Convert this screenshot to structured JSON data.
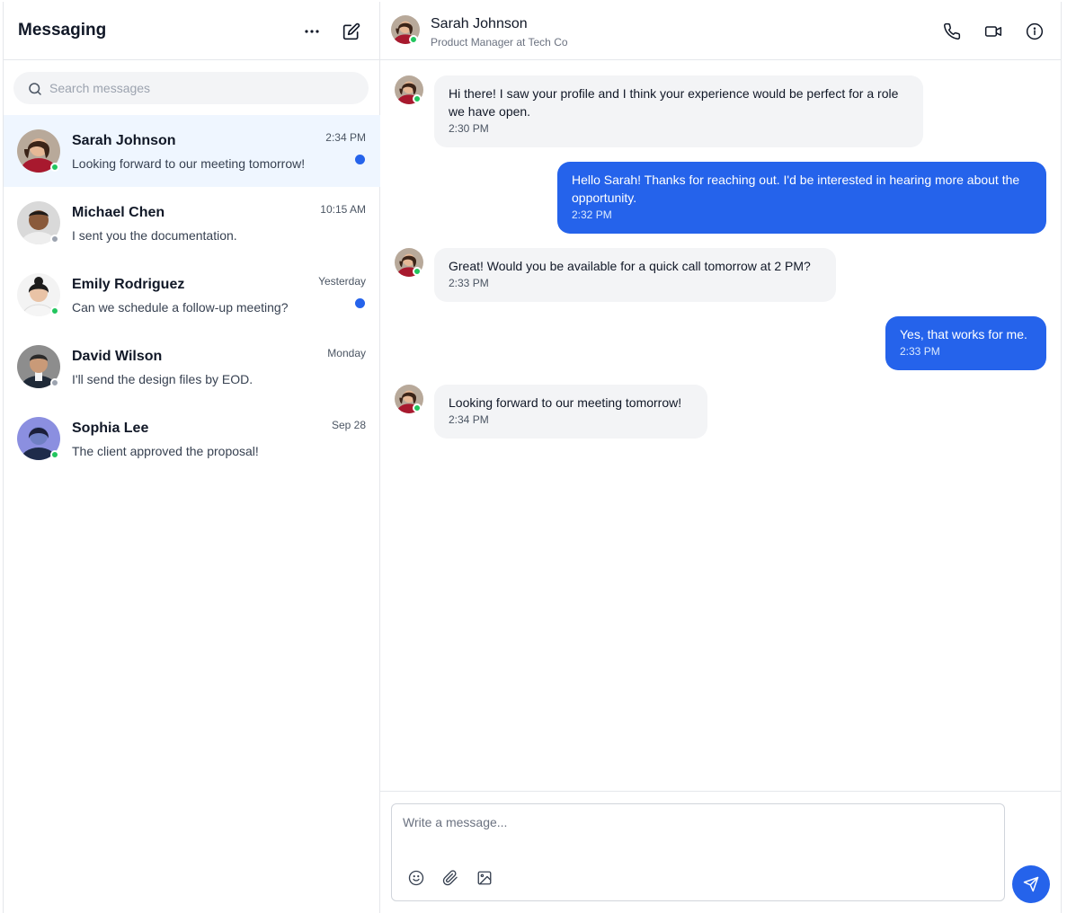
{
  "sidebar": {
    "title": "Messaging",
    "more_icon": "more-horizontal-icon",
    "compose_icon": "edit-compose-icon",
    "search": {
      "placeholder": "Search messages",
      "value": ""
    },
    "conversations": [
      {
        "name": "Sarah Johnson",
        "time": "2:34 PM",
        "preview": "Looking forward to our meeting tomorrow!",
        "unread": true,
        "online": true,
        "active": true
      },
      {
        "name": "Michael Chen",
        "time": "10:15 AM",
        "preview": "I sent you the documentation.",
        "unread": false,
        "online": false,
        "active": false
      },
      {
        "name": "Emily Rodriguez",
        "time": "Yesterday",
        "preview": "Can we schedule a follow-up meeting?",
        "unread": true,
        "online": true,
        "active": false
      },
      {
        "name": "David Wilson",
        "time": "Monday",
        "preview": "I'll send the design files by EOD.",
        "unread": false,
        "online": false,
        "active": false
      },
      {
        "name": "Sophia Lee",
        "time": "Sep 28",
        "preview": "The client approved the proposal!",
        "unread": false,
        "online": true,
        "active": false
      }
    ]
  },
  "chat": {
    "contact_name": "Sarah Johnson",
    "contact_subtitle": "Product Manager at Tech Co",
    "header_icons": [
      "phone-icon",
      "video-icon",
      "info-icon"
    ],
    "messages": [
      {
        "direction": "in",
        "text": "Hi there! I saw your profile and I think your experience would be perfect for a role we have open.",
        "time": "2:30 PM"
      },
      {
        "direction": "out",
        "text": "Hello Sarah! Thanks for reaching out. I'd be interested in hearing more about the opportunity.",
        "time": "2:32 PM"
      },
      {
        "direction": "in",
        "text": "Great! Would you be available for a quick call tomorrow at 2 PM?",
        "time": "2:33 PM"
      },
      {
        "direction": "out",
        "text": "Yes, that works for me.",
        "time": "2:33 PM"
      },
      {
        "direction": "in",
        "text": "Looking forward to our meeting tomorrow!",
        "time": "2:34 PM"
      }
    ],
    "composer": {
      "placeholder": "Write a message...",
      "value": "",
      "tools": [
        "emoji-icon",
        "paperclip-icon",
        "image-icon"
      ],
      "send_icon": "send-icon"
    }
  },
  "colors": {
    "accent": "#2563eb",
    "active_row": "#eff6ff",
    "incoming_bubble": "#f3f4f6",
    "online": "#22c55e",
    "offline": "#9ca3af"
  }
}
